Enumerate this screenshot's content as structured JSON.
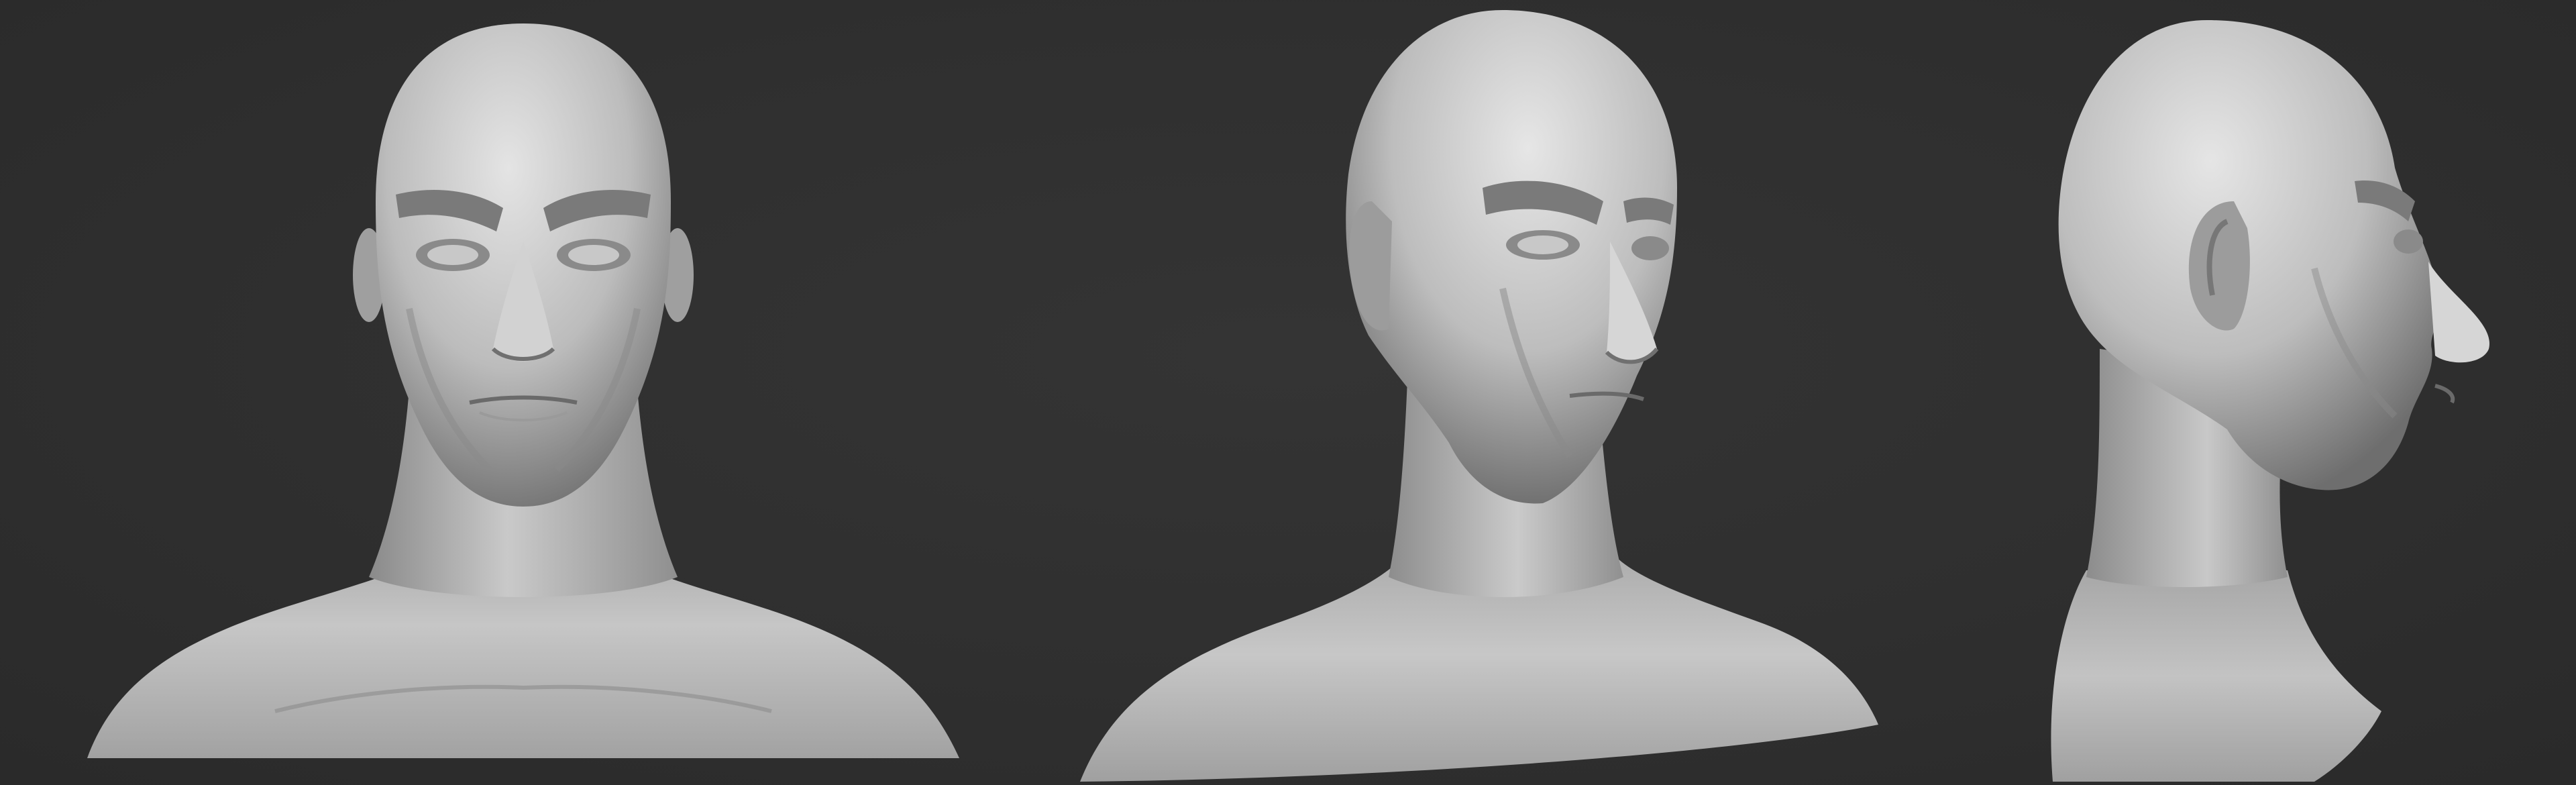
{
  "scene": {
    "background_color": "#2f2f2f",
    "material_color": "#bdbdbd",
    "views": [
      {
        "id": "front",
        "icon": "sculpt-bust-front"
      },
      {
        "id": "three-quarter",
        "icon": "sculpt-bust-three-quarter"
      },
      {
        "id": "profile",
        "icon": "sculpt-bust-profile-right"
      }
    ]
  }
}
